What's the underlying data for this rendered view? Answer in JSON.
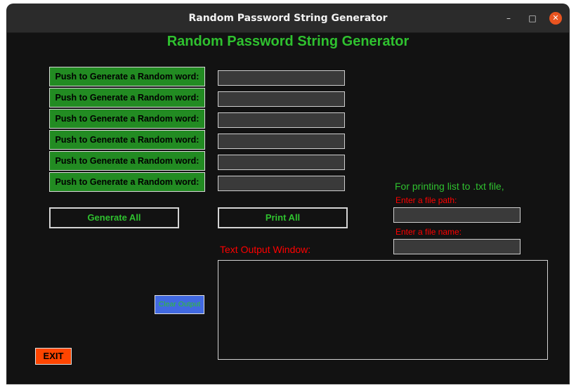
{
  "window": {
    "title": "Random Password String Generator",
    "controls": {
      "minimize": "–",
      "maximize": "□",
      "close": "✕"
    }
  },
  "heading": "Random Password String Generator",
  "generator_rows": [
    {
      "button_label": "Push to Generate a Random word:",
      "value": ""
    },
    {
      "button_label": "Push to Generate a Random word:",
      "value": ""
    },
    {
      "button_label": "Push to Generate a Random word:",
      "value": ""
    },
    {
      "button_label": "Push to Generate a Random word:",
      "value": ""
    },
    {
      "button_label": "Push to Generate a Random word:",
      "value": ""
    },
    {
      "button_label": "Push to Generate a Random word:",
      "value": ""
    }
  ],
  "actions": {
    "generate_all": "Generate All",
    "print_all": "Print All",
    "clear_output": "Clear Output",
    "exit": "EXIT"
  },
  "file_panel": {
    "heading": "For printing list to .txt file,",
    "path_label": "Enter a file path:",
    "path_value": "",
    "name_label": "Enter a file name:",
    "name_value": ""
  },
  "output_label": "Text Output Window:",
  "output_text": "",
  "colors": {
    "background": "#121212",
    "accent_green": "#2fc12f",
    "button_green": "#228b22",
    "field_gray": "#3a3a3a",
    "label_red": "#ff0000",
    "clear_blue": "#4169e1",
    "exit_orange": "#ff4500",
    "close_orange": "#e95420"
  }
}
